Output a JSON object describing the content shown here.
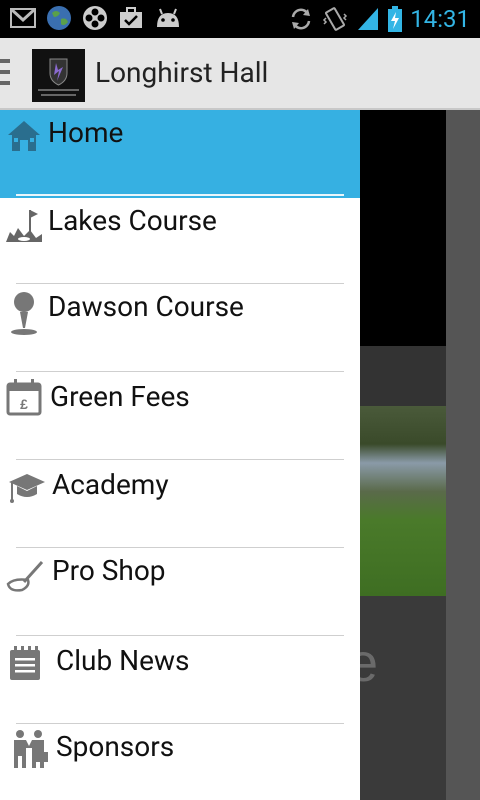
{
  "status_bar": {
    "time": "14:31",
    "icons": [
      "gmail-icon",
      "globe-icon",
      "film-reel-icon",
      "briefcase-check-icon",
      "android-icon",
      "sync-icon",
      "vibrate-icon",
      "signal-icon",
      "battery-charging-icon"
    ]
  },
  "action_bar": {
    "title": "Longhirst Hall",
    "logo_text": "VENUE GUIDE & GOLF GPS"
  },
  "background": {
    "partial_text": "e"
  },
  "drawer": {
    "items": [
      {
        "label": "Home",
        "icon": "house-icon",
        "selected": true
      },
      {
        "label": "Lakes Course",
        "icon": "golf-course-icon"
      },
      {
        "label": "Dawson Course",
        "icon": "golf-ball-tee-icon"
      },
      {
        "label": "Green Fees",
        "icon": "calendar-pound-icon"
      },
      {
        "label": "Academy",
        "icon": "graduation-cap-icon"
      },
      {
        "label": "Pro Shop",
        "icon": "golf-club-icon"
      },
      {
        "label": "Club News",
        "icon": "notepad-icon"
      },
      {
        "label": "Sponsors",
        "icon": "handshake-icon"
      }
    ],
    "selected_color": "#36b0e2"
  }
}
